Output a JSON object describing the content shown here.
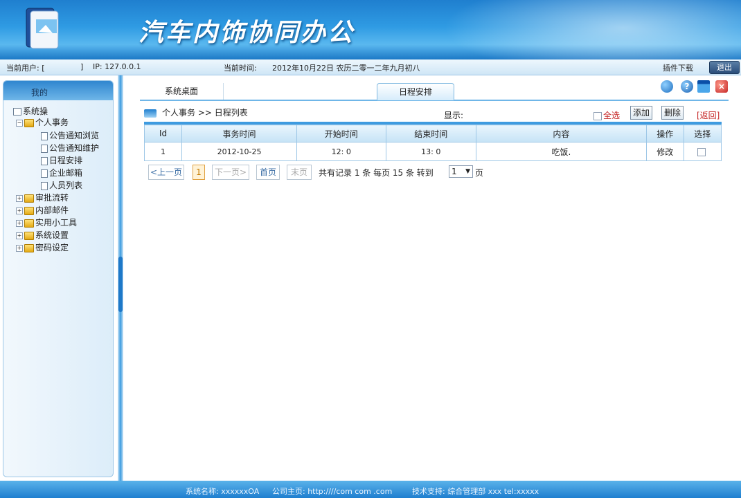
{
  "app": {
    "title": "汽车内饰协同办公"
  },
  "status": {
    "user_label": "当前用户: [",
    "user_value": "]",
    "ip": "IP: 127.0.0.1",
    "time_label": "当前时间:",
    "time_value": "2012年10月22日 农历二零一二年九月初八",
    "plugin": "插件下载",
    "logout": "退出"
  },
  "sidebar": {
    "header": "我的",
    "root": "系统操",
    "group_open": "个人事务",
    "items": [
      "公告通知浏览",
      "公告通知维护",
      "日程安排",
      "企业邮箱",
      "人员列表"
    ],
    "groups": [
      "审批流转",
      "内部邮件",
      "实用小工具",
      "系统设置",
      "密码设定"
    ]
  },
  "tabs": [
    {
      "label": "系统桌面"
    },
    {
      "label": "日程安排"
    }
  ],
  "toolbar_icons": [
    "refresh-icon",
    "help-icon",
    "window-icon",
    "close-icon"
  ],
  "breadcrumb": {
    "text": "个人事务 >> 日程列表"
  },
  "actions": {
    "display_label": "显示:",
    "select_all": "全选",
    "add": "添加",
    "delete": "删除",
    "back": "[返回]"
  },
  "table": {
    "headers": [
      "Id",
      "事务时间",
      "开始时间",
      "结束时间",
      "内容",
      "操作",
      "选择"
    ],
    "rows": [
      {
        "id": "1",
        "date": "2012-10-25",
        "start": "12: 0",
        "end": "13: 0",
        "content": "吃饭.",
        "op": "修改"
      }
    ]
  },
  "pager": {
    "prev": "<上一页",
    "current": "1",
    "next": "下一页>",
    "first": "首页",
    "last": "末页",
    "summary": "共有记录 1 条  每页 15 条  转到",
    "goto_value": "1",
    "page_suffix": "页"
  },
  "footer": {
    "system": "系统名称: xxxxxxOA",
    "homepage": "公司主页: http:////com  com .com",
    "support": "技术支持: 综合管理部 xxx tel:xxxxx"
  }
}
